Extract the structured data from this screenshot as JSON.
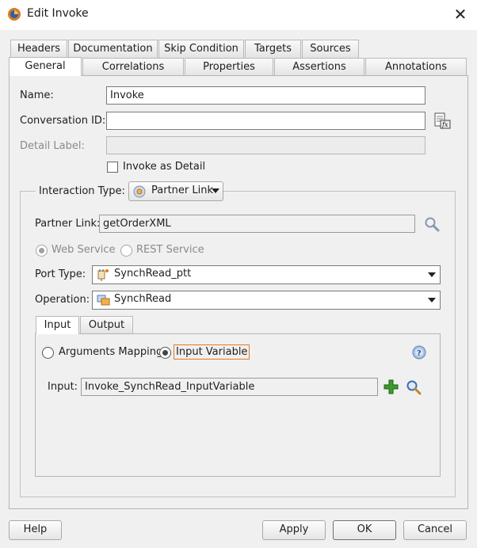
{
  "window": {
    "title": "Edit Invoke",
    "close_glyph": "✕"
  },
  "tabs_row1": [
    "Headers",
    "Documentation",
    "Skip Condition",
    "Targets",
    "Sources"
  ],
  "tabs_row2": [
    "General",
    "Correlations",
    "Properties",
    "Assertions",
    "Annotations"
  ],
  "general": {
    "name_label": "Name:",
    "name_value": "Invoke",
    "conversation_label": "Conversation ID:",
    "conversation_value": "",
    "detail_label": "Detail Label:",
    "detail_value": "",
    "invoke_as_detail": "Invoke as Detail"
  },
  "interaction": {
    "label": "Interaction Type:",
    "type": "Partner Link",
    "partner_link_label": "Partner Link:",
    "partner_link_value": "getOrderXML",
    "web_service": "Web Service",
    "rest_service": "REST Service",
    "port_type_label": "Port Type:",
    "port_type_value": "SynchRead_ptt",
    "operation_label": "Operation:",
    "operation_value": "SynchRead"
  },
  "io_tabs": [
    "Input",
    "Output"
  ],
  "input": {
    "arguments_mapping": "Arguments Mapping",
    "input_variable": "Input Variable",
    "input_label": "Input:",
    "input_value": "Invoke_SynchRead_InputVariable"
  },
  "footer": {
    "help": "Help",
    "apply": "Apply",
    "ok": "OK",
    "cancel": "Cancel"
  },
  "colors": {
    "focus_orange": "#e07b1f",
    "add_green": "#2e8b2e",
    "help_blue": "#6b93c8"
  }
}
